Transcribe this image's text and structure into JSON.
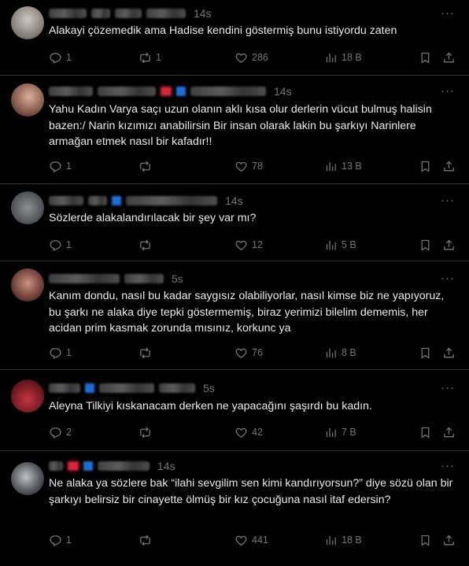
{
  "tweets": [
    {
      "time": "14s",
      "text": "Alakayi çözemedik ama Hadise kendini göstermiş bunu istiyordu zaten",
      "replies": "1",
      "retweets": "1",
      "likes": "286",
      "views": "18 B",
      "avatar_color": "#a9a6a0"
    },
    {
      "time": "14s",
      "text": "Yahu Kadın Varya saçı uzun olanın aklı kısa olur derlerin vücut bulmuş halisin bazen:/ Narin kızımızı anabilirsin Bir insan olarak lakin bu şarkıyı Narinlere armağan etmek nasıl bir kafadır!!",
      "replies": "1",
      "retweets": "",
      "likes": "78",
      "views": "13 B",
      "avatar_color": "#b48a78"
    },
    {
      "time": "14s",
      "text": "Sözlerde alakalandırılacak bir şey var mı?",
      "replies": "1",
      "retweets": "",
      "likes": "12",
      "views": "5 B",
      "avatar_color": "#6b6e72"
    },
    {
      "time": "5s",
      "text": "Kanım dondu, nasıl bu kadar saygısız olabiliyorlar, nasıl kimse biz ne yapıyoruz, bu şarkı ne alaka diye tepki göstermemiş, biraz yerimizi bilelim dememis, her acidan prim kasmak zorunda mısınız, korkunc ya",
      "replies": "1",
      "retweets": "",
      "likes": "76",
      "views": "8 B",
      "avatar_color": "#8e5a52"
    },
    {
      "time": "5s",
      "text": "Aleyna Tilkiyi kıskanacam derken ne yapacağını şaşırdı bu kadın.",
      "replies": "2",
      "retweets": "",
      "likes": "42",
      "views": "7 B",
      "avatar_color": "#9a2e36"
    },
    {
      "time": "14s",
      "text": "Ne alaka ya sözlere bak “ilahi sevgilim sen kimi kandırıyorsun?” diye sözü olan bir şarkıyı belirsiz bir cinayette ölmüş bir kız çocuğuna nasıl itaf edersin?",
      "replies": "1",
      "retweets": "",
      "likes": "441",
      "views": "18 B",
      "avatar_color": "#4a4d55"
    }
  ],
  "more_label": "···",
  "icons": [
    "reply-icon",
    "retweet-icon",
    "like-icon",
    "views-icon",
    "bookmark-icon",
    "share-icon"
  ]
}
